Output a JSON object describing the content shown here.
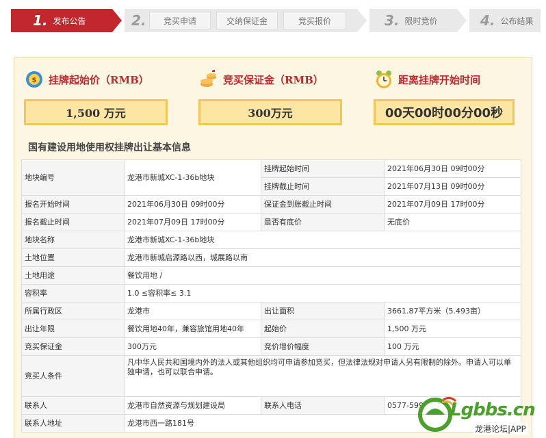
{
  "steps": {
    "step1": {
      "num": "1.",
      "label": "发布公告"
    },
    "step2": {
      "num": "2."
    },
    "sub": [
      "竞买申请",
      "交纳保证金",
      "竞买报价"
    ],
    "step3": {
      "num": "3.",
      "label": "限时竞价"
    },
    "step4": {
      "num": "4.",
      "label": "公布结果"
    }
  },
  "cards": {
    "start_price": {
      "title": "挂牌起始价（RMB）",
      "value": "1,500  万元",
      "icon": "money-cycle-icon"
    },
    "deposit": {
      "title": "竞买保证金（RMB）",
      "value": "300万元",
      "icon": "coins-icon"
    },
    "countdown": {
      "title": "距离挂牌开始时间",
      "value": "00天00时00分00秒",
      "icon": "alarm-clock-icon"
    }
  },
  "section_title": "国有建设用地使用权挂牌出让基本信息",
  "table": {
    "parcel_no_k": "地块编号",
    "parcel_no_v": "龙港市新城XC-1-36b地块",
    "list_start_k": "挂牌起始时间",
    "list_start_v": "2021年06月30日 09时00分",
    "list_end_k": "挂牌截止时间",
    "list_end_v": "2021年07月13日 09时00分",
    "reg_start_k": "报名开始时间",
    "reg_start_v": "2021年06月30日 09时00分",
    "deposit_deadline_k": "保证金到账截止时间",
    "deposit_deadline_v": "2021年07月09日 17时00分",
    "reg_end_k": "报名截止时间",
    "reg_end_v": "2021年07月09日 17时00分",
    "reserve_k": "是否有底价",
    "reserve_v": "无底价",
    "name_k": "地块名称",
    "name_v": "龙港市新城XC-1-36b地块",
    "location_k": "土地位置",
    "location_v": "龙港市新城启源路以西，城展路以南",
    "use_k": "土地用途",
    "use_v": "餐饮用地 /",
    "far_k": "容积率",
    "far_v": "1.0 ≤容积率≤ 3.1",
    "district_k": "所属行政区",
    "district_v": "龙港市",
    "area_k": "出让面积",
    "area_v": "3661.87平方米（5.493亩）",
    "term_k": "出让年限",
    "term_v": "餐饮用地40年，兼容旅馆用地40年",
    "start_price_k": "起始价",
    "start_price_v": "1,500 万元",
    "bid_deposit_k": "竞买保证金",
    "bid_deposit_v": "300万元",
    "increment_k": "竞价增价幅度",
    "increment_v": "100 万元",
    "conditions_k": "竞买人条件",
    "conditions_v": "凡中华人民共和国境内外的法人或其他组织均可申请参加竞买，但法律法规对申请人另有限制的除外。申请人可以单独申请，也可以联合申请。",
    "contact_k": "联系人",
    "contact_v": "龙港市自然资源与规划建设局",
    "phone_k": "联系人电话",
    "phone_v": "0577-599",
    "address_k": "联系人地址",
    "address_v": "龙港市西一路181号"
  },
  "watermark": {
    "logo": "Lgbbs.cn",
    "sub": "龙港论坛|APP"
  },
  "colors": {
    "accent": "#c1272d",
    "gold": "#f1c65b",
    "gold_fill": "#fde6a3",
    "panel": "#fdf6e3",
    "brand_green": "#4aa02a"
  }
}
